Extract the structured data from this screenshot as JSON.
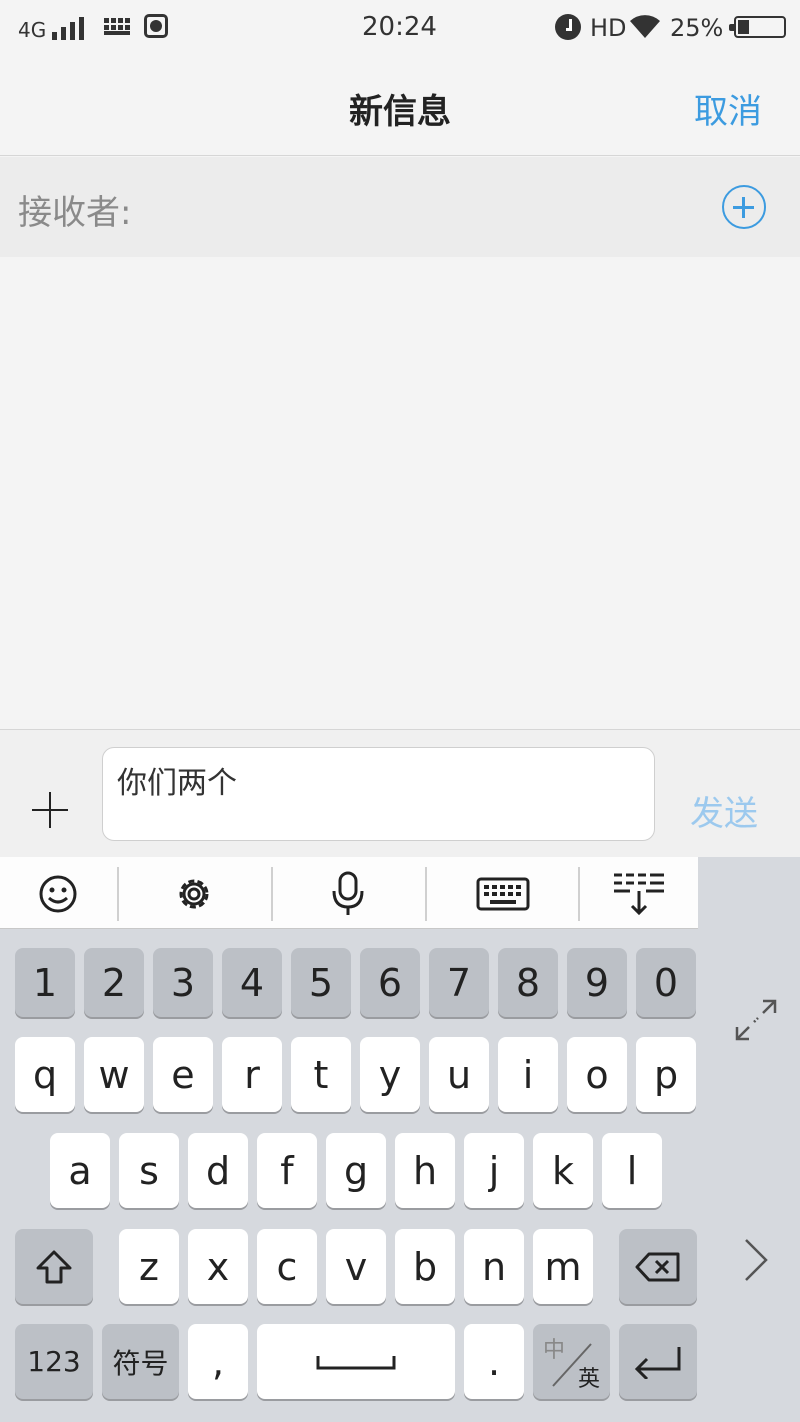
{
  "status_bar": {
    "network": "4G",
    "time": "20:24",
    "hd": "HD",
    "battery_pct": "25%"
  },
  "header": {
    "title": "新信息",
    "cancel_label": "取消"
  },
  "recipient": {
    "label": "接收者:"
  },
  "compose": {
    "message_text": "你们两个",
    "send_label": "发送"
  },
  "keyboard": {
    "toolbar_icons": [
      "emoji-icon",
      "gear-icon",
      "microphone-icon",
      "keyboard-icon",
      "collapse-keyboard-icon"
    ],
    "number_row": [
      "1",
      "2",
      "3",
      "4",
      "5",
      "6",
      "7",
      "8",
      "9",
      "0"
    ],
    "row1": [
      "q",
      "w",
      "e",
      "r",
      "t",
      "y",
      "u",
      "i",
      "o",
      "p"
    ],
    "row2": [
      "a",
      "s",
      "d",
      "f",
      "g",
      "h",
      "j",
      "k",
      "l"
    ],
    "row3": [
      "z",
      "x",
      "c",
      "v",
      "b",
      "n",
      "m"
    ],
    "bottom": {
      "num_label": "123",
      "symbol_label": "符号",
      "comma": ",",
      "period": ".",
      "lang_top": "中",
      "lang_bottom": "英"
    }
  }
}
